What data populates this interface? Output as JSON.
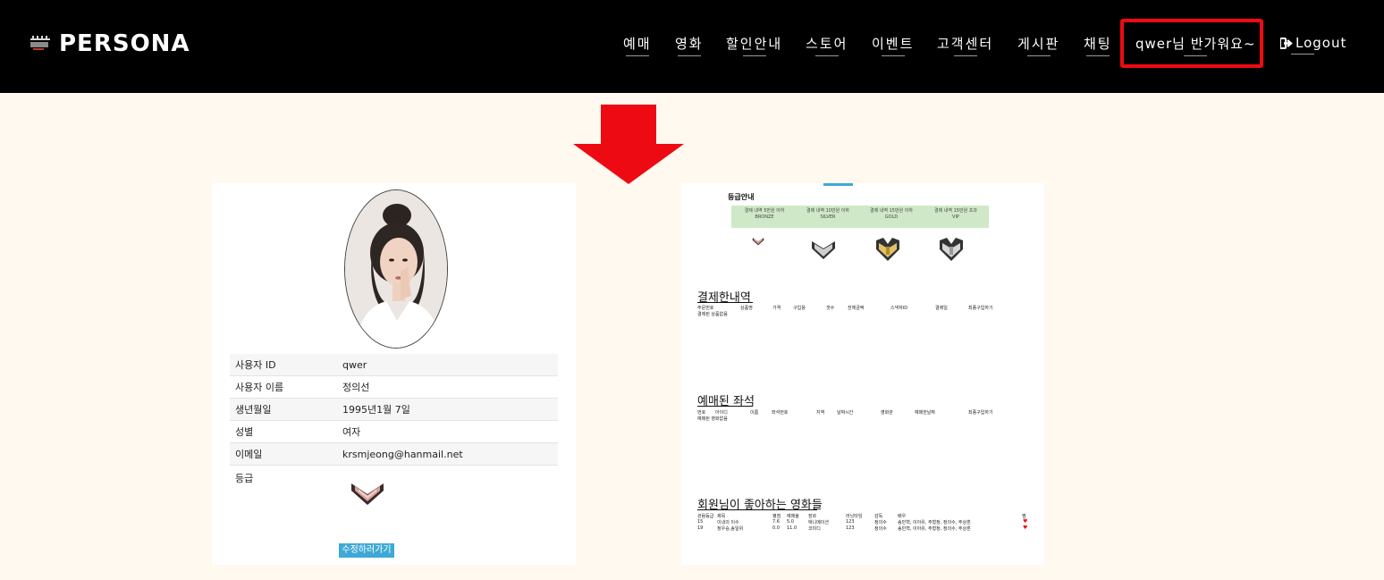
{
  "header": {
    "brand": "PERSONA",
    "nav": [
      "예매",
      "영화",
      "할인안내",
      "스토어",
      "이벤트",
      "고객센터",
      "게시판",
      "채팅"
    ],
    "greeting": "qwer님 반가워요~",
    "logout_label": "Logout"
  },
  "colors": {
    "header_bg": "#000000",
    "page_bg": "#fff9f0",
    "highlight": "#ee0a12",
    "accent": "#3fa9d6"
  },
  "profile": {
    "rows": [
      {
        "label": "사용자 ID",
        "value": "qwer"
      },
      {
        "label": "사용자 이름",
        "value": "정의선"
      },
      {
        "label": "생년월일",
        "value": "1995년1월 7일"
      },
      {
        "label": "성별",
        "value": "여자"
      },
      {
        "label": "이메일",
        "value": "krsmjeong@hanmail.net"
      }
    ],
    "grade_label": "등급",
    "edit_button": "수정하러가기"
  },
  "grade_guide": {
    "title": "등급안내",
    "tiers": [
      {
        "desc": "결제 내역 5만원 이하",
        "name": "BRONZE"
      },
      {
        "desc": "결제 내역 10만원 이하",
        "name": "SILVER"
      },
      {
        "desc": "결제 내역 15만원 이하",
        "name": "GOLD"
      },
      {
        "desc": "결제 내역 15만원 초과",
        "name": "VIP"
      }
    ]
  },
  "payments": {
    "title": "결제한내역",
    "columns": [
      "주문번호",
      "상품명",
      "가격",
      "구입용",
      "갯수",
      "전체금액",
      "스낵자ID",
      "결제일",
      "최종구입하기"
    ],
    "empty": "결제된 상품없음"
  },
  "reserved": {
    "title": "예매된 좌석",
    "columns": [
      "번호",
      "아이디",
      "이름",
      "좌석번호",
      "지역",
      "날짜시간",
      "영화관",
      "예매한날짜",
      "최종구입하기"
    ],
    "empty": "예매된 영화없음"
  },
  "liked": {
    "title": "회원님이 좋아하는 영화들",
    "columns": [
      "관람등급",
      "제목",
      "평점",
      "예매율",
      "장르",
      "러닝타임",
      "감독",
      "배우",
      "찜"
    ],
    "rows": [
      {
        "rating": "15",
        "title": "이내의 이수",
        "score": "7.6",
        "rate": "5.0",
        "genre": "애니메이션",
        "runtime": "123",
        "director": "정의수",
        "actors": "송민혁, 이아유, 주형정, 정의수, 주상훈"
      },
      {
        "rating": "19",
        "title": "정우승,송일위",
        "score": "0.0",
        "rate": "11.0",
        "genre": "코미디",
        "runtime": "123",
        "director": "정의수",
        "actors": "송민혁, 이아유, 주형정, 정의수, 주상훈"
      }
    ]
  }
}
